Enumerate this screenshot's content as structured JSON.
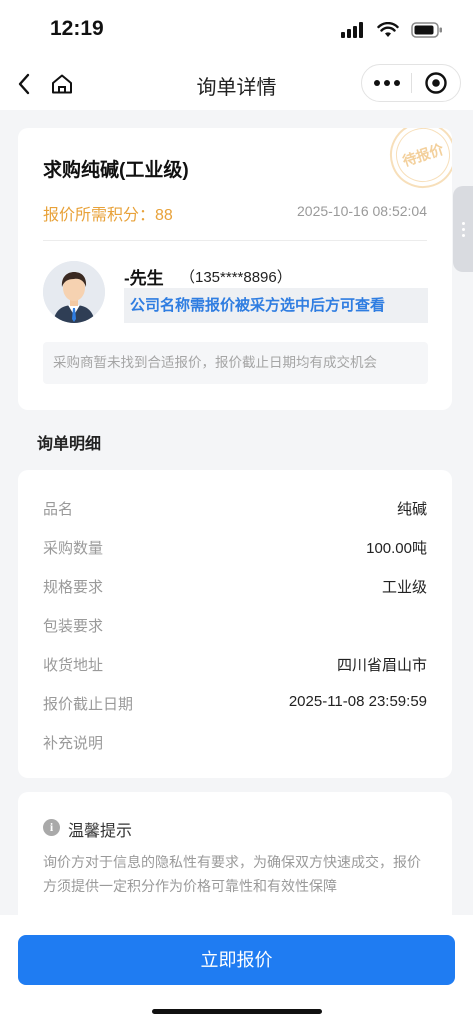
{
  "status_bar": {
    "time": "12:19"
  },
  "nav": {
    "title": "询单详情",
    "icons": [
      "back-icon",
      "home-icon",
      "more-icon",
      "close-target-icon"
    ]
  },
  "inquiry": {
    "product_title": "求购纯碱(工业级)",
    "points_label": "报价所需积分：",
    "points_value": "88",
    "post_time": "2025-10-16 08:52:04",
    "stamp_text": "待报价",
    "buyer_name": "-先生",
    "buyer_phone": "（135****8896）",
    "company_hidden_text": "公司名称需报价被采方选中后方可查看",
    "notice": "采购商暂未找到合适报价，报价截止日期均有成交机会"
  },
  "details": {
    "section_title": "询单明细",
    "rows": [
      {
        "label": "品名",
        "value": "纯碱"
      },
      {
        "label": "采购数量",
        "value": "100.00吨"
      },
      {
        "label": "规格要求",
        "value": "工业级"
      },
      {
        "label": "包装要求",
        "value": ""
      },
      {
        "label": "收货地址",
        "value": "四川省眉山市"
      },
      {
        "label": "报价截止日期",
        "value": "2025-11-08 23:59:59"
      },
      {
        "label": "补充说明",
        "value": ""
      }
    ]
  },
  "tip": {
    "title": "温馨提示",
    "text": "询价方对于信息的隐私性有要求，为确保双方快速成交，报价方须提供一定积分作为价格可靠性和有效性保障"
  },
  "action": {
    "quote_button": "立即报价"
  },
  "colors": {
    "accent": "#1f7cf2",
    "points": "#e8a23a",
    "company_link": "#2f7de1",
    "background": "#f4f5f7"
  }
}
